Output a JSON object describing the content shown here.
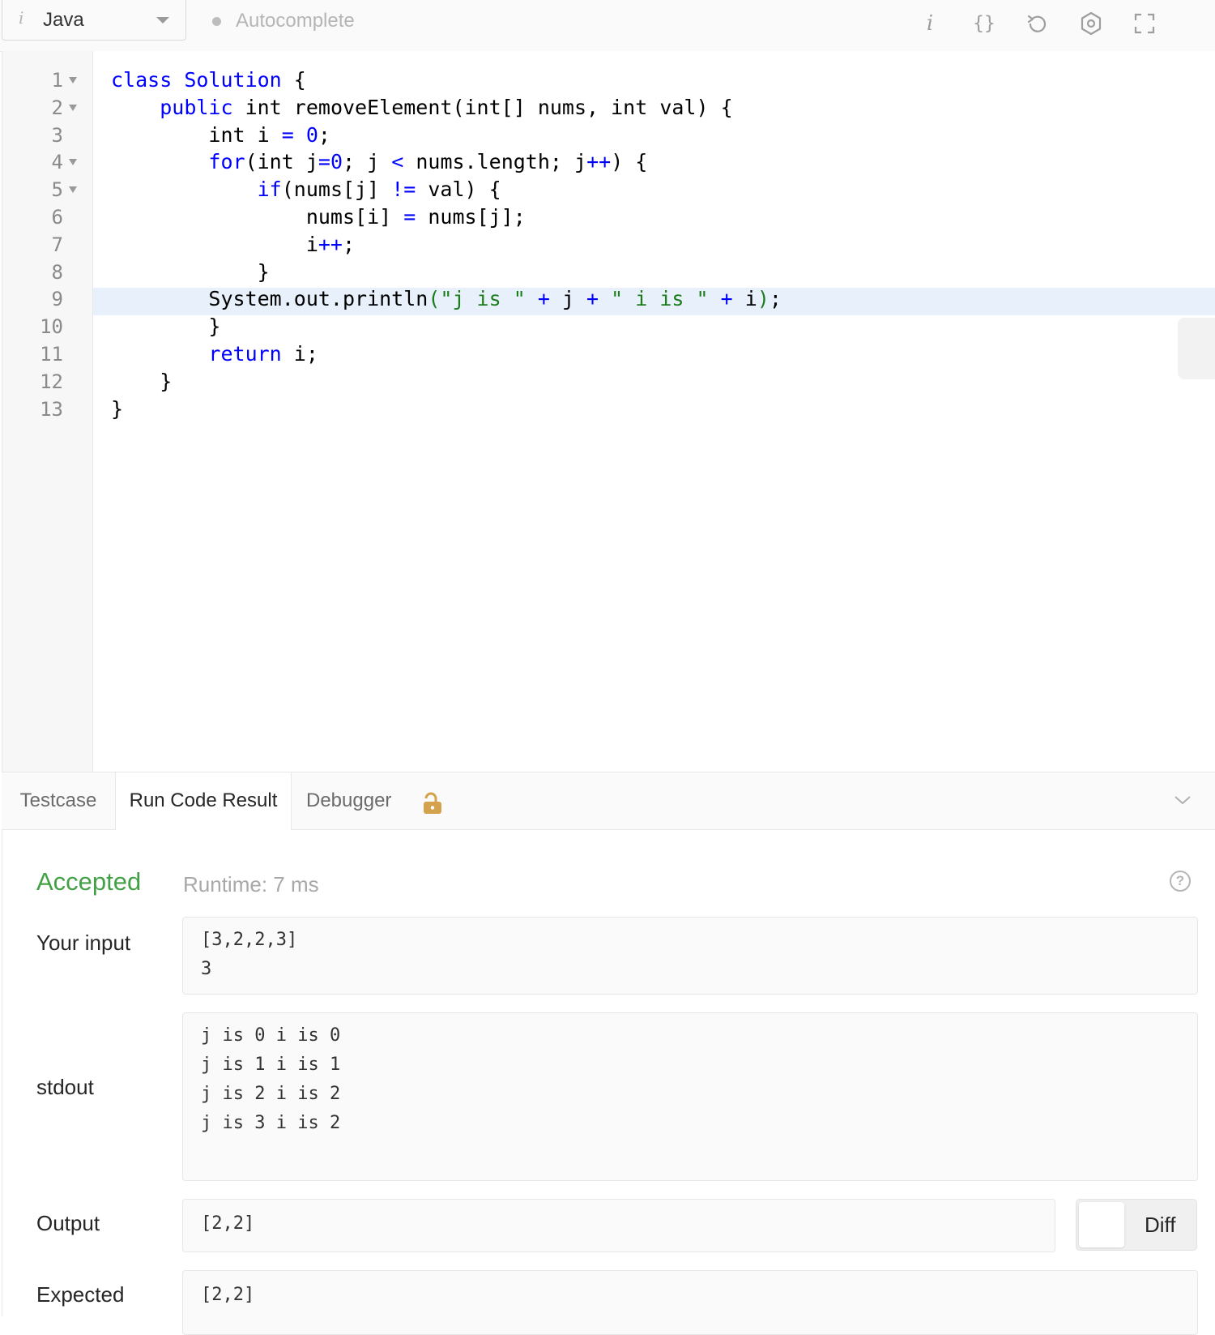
{
  "toolbar": {
    "language": "Java",
    "language_icon": "i",
    "autocomplete_label": "Autocomplete",
    "buttons": [
      {
        "name": "info-icon",
        "glyph": "i"
      },
      {
        "name": "format-braces-icon",
        "glyph": "{}"
      },
      {
        "name": "reset-icon",
        "glyph": "undo"
      },
      {
        "name": "settings-icon",
        "glyph": "gear"
      },
      {
        "name": "fullscreen-icon",
        "glyph": "expand"
      }
    ]
  },
  "editor": {
    "active_line": 9,
    "line_numbers": [
      "1",
      "2",
      "3",
      "4",
      "5",
      "6",
      "7",
      "8",
      "9",
      "10",
      "11",
      "12",
      "13"
    ],
    "foldable_lines": [
      1,
      2,
      4,
      5
    ],
    "code_lines": [
      [
        [
          "kw",
          "class"
        ],
        [
          "t",
          " "
        ],
        [
          "cls",
          "Solution"
        ],
        [
          "t",
          " {"
        ]
      ],
      [
        [
          "t",
          "    "
        ],
        [
          "kw",
          "public"
        ],
        [
          "t",
          " int removeElement(int[] nums, int val) {"
        ]
      ],
      [
        [
          "t",
          "        int i "
        ],
        [
          "op",
          "="
        ],
        [
          "t",
          " "
        ],
        [
          "num",
          "0"
        ],
        [
          "t",
          ";"
        ]
      ],
      [
        [
          "t",
          "        "
        ],
        [
          "kw",
          "for"
        ],
        [
          "t",
          "(int j"
        ],
        [
          "op",
          "="
        ],
        [
          "num",
          "0"
        ],
        [
          "t",
          "; j "
        ],
        [
          "op",
          "<"
        ],
        [
          "t",
          " nums.length; j"
        ],
        [
          "op",
          "++"
        ],
        [
          "t",
          ") {"
        ]
      ],
      [
        [
          "t",
          "            "
        ],
        [
          "kw",
          "if"
        ],
        [
          "t",
          "(nums[j] "
        ],
        [
          "op",
          "!="
        ],
        [
          "t",
          " val) {"
        ]
      ],
      [
        [
          "t",
          "                nums[i] "
        ],
        [
          "op",
          "="
        ],
        [
          "t",
          " nums[j];"
        ]
      ],
      [
        [
          "t",
          "                i"
        ],
        [
          "op",
          "++"
        ],
        [
          "t",
          ";"
        ]
      ],
      [
        [
          "t",
          "            }"
        ]
      ],
      [
        [
          "t",
          "        System.out.println"
        ],
        [
          "str",
          "(\"j is \""
        ],
        [
          "t",
          " "
        ],
        [
          "op",
          "+"
        ],
        [
          "t",
          " j "
        ],
        [
          "op",
          "+"
        ],
        [
          "t",
          " "
        ],
        [
          "str",
          "\" i is \""
        ],
        [
          "t",
          " "
        ],
        [
          "op",
          "+"
        ],
        [
          "t",
          " i"
        ],
        [
          "str",
          ")"
        ],
        [
          "t",
          ";"
        ]
      ],
      [
        [
          "t",
          "        }"
        ]
      ],
      [
        [
          "t",
          "        "
        ],
        [
          "kw",
          "return"
        ],
        [
          "t",
          " i;"
        ]
      ],
      [
        [
          "t",
          "    }"
        ]
      ],
      [
        [
          "t",
          "}"
        ]
      ]
    ]
  },
  "tabs": [
    {
      "label": "Testcase",
      "active": false
    },
    {
      "label": "Run Code Result",
      "active": true
    },
    {
      "label": "Debugger",
      "active": false,
      "icon": "lock-icon"
    }
  ],
  "result": {
    "status": "Accepted",
    "runtime": "Runtime: 7 ms",
    "input_label": "Your input",
    "input_value": "[3,2,2,3]\n3",
    "stdout_label": "stdout",
    "stdout_value": "j is 0 i is 0\nj is 1 i is 1\nj is 2 i is 2\nj is 3 i is 2",
    "output_label": "Output",
    "output_value": "[2,2]",
    "diff_label": "Diff",
    "expected_label": "Expected",
    "expected_value": "[2,2]"
  },
  "colors": {
    "keyword": "#0000ff",
    "string": "#1a7d1a",
    "accepted": "#43a047",
    "active_line_bg": "#e8f1fb",
    "lock": "#d4a24c"
  }
}
